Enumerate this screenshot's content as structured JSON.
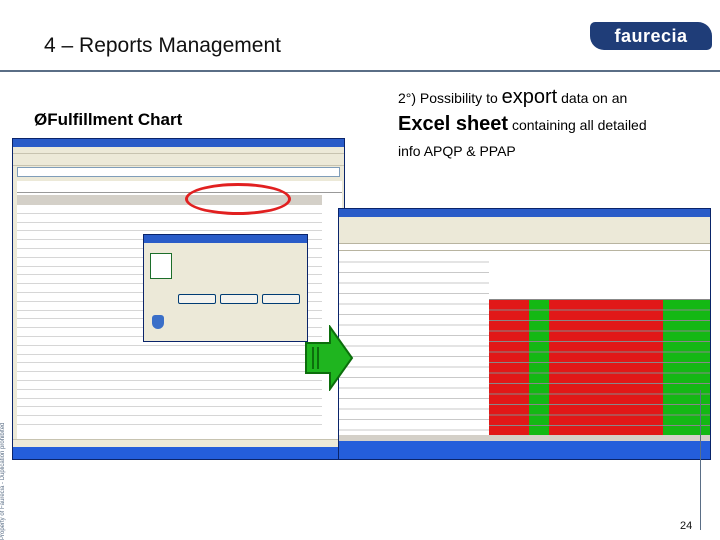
{
  "slide": {
    "title": "4 – Reports Management",
    "logo_text": "faurecia",
    "side_text": "Property of Faurecia - Duplication prohibited",
    "page_number": "24",
    "accent_color": "#1f3d78"
  },
  "bullet": {
    "marker": "Ø",
    "text": "Fulfillment Chart"
  },
  "callout": {
    "line1_prefix": "2°) Possibility to ",
    "line1_emph": "export",
    "line1_suffix": " data on an",
    "line2_emph": "Excel sheet",
    "line2_suffix": " containing all detailed",
    "line3": "info APQP & PPAP"
  },
  "highlight_colors": {
    "ring": "#e12020",
    "arrow": "#1fb51f",
    "cell_red": "#e11818",
    "cell_green": "#14b814"
  }
}
